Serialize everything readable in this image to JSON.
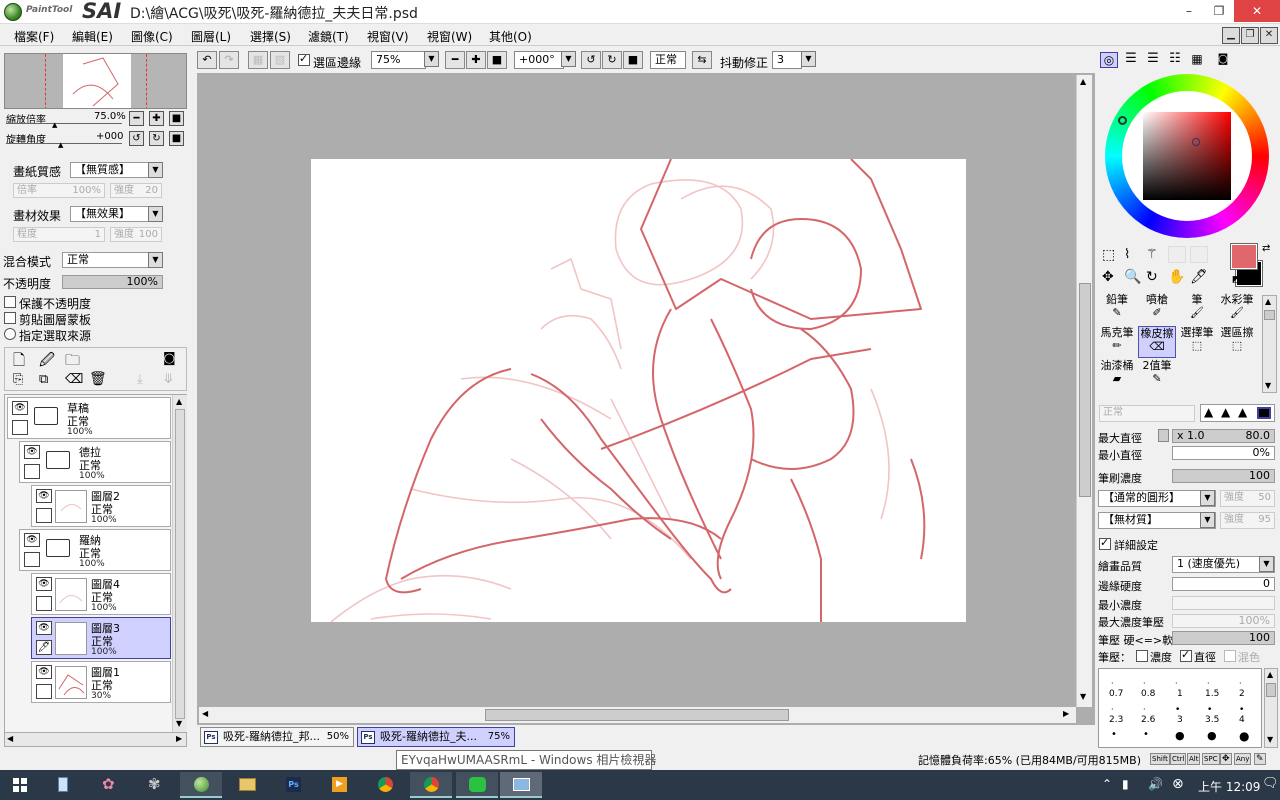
{
  "window": {
    "app_name": "PaintTool",
    "app_logo": "SAI",
    "title": "D:\\繪\\ACG\\吸死\\吸死-羅納德拉_夫夫日常.psd",
    "min": "–",
    "max": "❐",
    "close": "✕"
  },
  "menu": [
    "檔案(F)",
    "編輯(E)",
    "圖像(C)",
    "圖層(L)",
    "選擇(S)",
    "濾鏡(T)",
    "視窗(V)",
    "視窗(W)",
    "其他(O)"
  ],
  "toolbar": {
    "selection_edge": "選區邊緣",
    "zoom": "75%",
    "angle": "+000°",
    "mode": "正常",
    "stabilizer_label": "抖動修正",
    "stabilizer": "3"
  },
  "navigator": {
    "zoom_label": "縮放倍率",
    "zoom": "75.0%",
    "rot_label": "旋轉角度",
    "rot": "+000"
  },
  "texture": {
    "label": "畫紙質感",
    "value": "【無質感】",
    "rate_label": "倍率",
    "rate": "100%",
    "strength_label": "強度",
    "strength": "20"
  },
  "effect": {
    "label": "畫材效果",
    "value": "【無效果】",
    "degree_label": "程度",
    "degree": "1",
    "strength_label": "強度",
    "strength": "100"
  },
  "blend": {
    "label": "混合模式",
    "value": "正常"
  },
  "opacity": {
    "label": "不透明度",
    "value": "100%"
  },
  "checks": {
    "protect": "保護不透明度",
    "clip": "剪貼圖層蒙板",
    "source": "指定選取來源"
  },
  "layers": [
    {
      "name": "草稿",
      "mode": "正常",
      "op": "100%",
      "type": "folder"
    },
    {
      "name": "德拉",
      "mode": "正常",
      "op": "100%",
      "type": "folder"
    },
    {
      "name": "圖層2",
      "mode": "正常",
      "op": "100%",
      "type": "layer"
    },
    {
      "name": "羅納",
      "mode": "正常",
      "op": "100%",
      "type": "folder"
    },
    {
      "name": "圖層4",
      "mode": "正常",
      "op": "100%",
      "type": "layer"
    },
    {
      "name": "圖層3",
      "mode": "正常",
      "op": "100%",
      "type": "layer"
    },
    {
      "name": "圖層1",
      "mode": "正常",
      "op": "30%",
      "type": "layer"
    }
  ],
  "tools": [
    "鉛筆",
    "噴槍",
    "筆",
    "水彩筆",
    "馬克筆",
    "橡皮擦",
    "選擇筆",
    "選區擦",
    "油漆桶",
    "2值筆"
  ],
  "brush": {
    "mode": "正常",
    "max_size_label": "最大直徑",
    "max_size_mult": "x 1.0",
    "max_size": "80.0",
    "min_size_label": "最小直徑",
    "min_size": "0%",
    "density_label": "筆刷濃度",
    "density": "100",
    "shape": "【通常的圓形】",
    "shape_strength_label": "強度",
    "shape_strength": "50",
    "texture": "【無材質】",
    "texture_strength_label": "強度",
    "texture_strength": "95",
    "detail_label": "詳細設定",
    "quality_label": "繪畫品質",
    "quality": "1 (速度優先)",
    "edge_label": "邊緣硬度",
    "edge": "0",
    "min_density_label": "最小濃度",
    "min_density": "",
    "max_pressure_label": "最大濃度筆壓",
    "max_pressure": "100%",
    "pressure_label": "筆壓 硬<=>軟",
    "pressure": "100",
    "pressure_opt_label": "筆壓：",
    "opt_density": "濃度",
    "opt_size": "直徑",
    "opt_blend": "混色"
  },
  "brush_sizes": [
    "0.7",
    "0.8",
    "1",
    "1.5",
    "2",
    "2.3",
    "2.6",
    "3",
    "3.5",
    "4"
  ],
  "tabs": [
    {
      "name": "吸死-羅納德拉_邦...",
      "zoom": "50%",
      "icon": "Ps"
    },
    {
      "name": "吸死-羅納德拉_夫...",
      "zoom": "75%",
      "icon": "Ps"
    }
  ],
  "tooltip": "EYvqaHwUMAASRmL - Windows 相片檢視器",
  "status": "記憶體負荷率:65% (已用84MB/可用815MB)",
  "status_keys": [
    "Shift",
    "Ctrl",
    "Alt",
    "SPC",
    "Any"
  ],
  "clock": "上午 12:09",
  "colors": {
    "accent_sel": "#d0d0ff",
    "sketch": "#d4666a",
    "sketch_light": "#f0c0c0",
    "fg": "#e0676c",
    "bg": "#000000"
  }
}
